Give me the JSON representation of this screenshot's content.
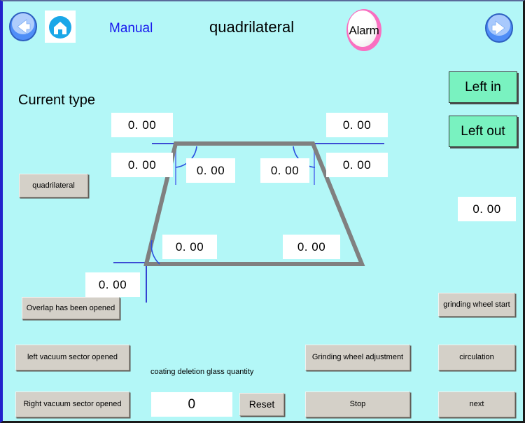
{
  "window": {
    "background_color": "#b3f7f7",
    "border_color": "#2222cc"
  },
  "header": {
    "back_icon": "back-arrow-icon",
    "home_icon": "home-icon",
    "forward_icon": "forward-arrow-icon",
    "mode_label": "Manual",
    "mode_color": "#1818ee",
    "title": "quadrilateral",
    "alarm_label": "Alarm",
    "alarm_ring_color": "#f96fc0",
    "alarm_lamp_color": "#ffffff"
  },
  "left_panel": {
    "current_type_label": "Current type",
    "current_type_button": "quadrilateral",
    "overlap_button": "Overlap has been opened",
    "left_vacuum_button": "left vacuum sector opened",
    "right_vacuum_button": "Right vacuum sector opened"
  },
  "right_panel": {
    "left_in_button": "Left in",
    "left_out_button": "Left out",
    "side_value": "0. 00",
    "grinding_wheel_start_button": "grinding wheel start",
    "circulation_button": "circulation",
    "next_button": "next"
  },
  "bottom_panel": {
    "coating_label": "coating deletion glass quantity",
    "coating_value": "0",
    "reset_button": "Reset",
    "grinding_wheel_adjustment_button": "Grinding wheel adjustment",
    "stop_button": "Stop"
  },
  "diagram": {
    "shape_name": "quadrilateral",
    "outline_color": "#808080",
    "guide_line_color": "#1414c8",
    "angle_arc_color": "#2a4fe0",
    "top_left_length": "0. 00",
    "top_right_length": "0. 00",
    "left_side_length": "0. 00",
    "right_side_length": "0. 00",
    "top_left_angle": "0. 00",
    "top_right_angle": "0. 00",
    "bottom_left_angle": "0. 00",
    "bottom_right_angle": "0. 00",
    "bottom_left_value": "0. 00"
  }
}
